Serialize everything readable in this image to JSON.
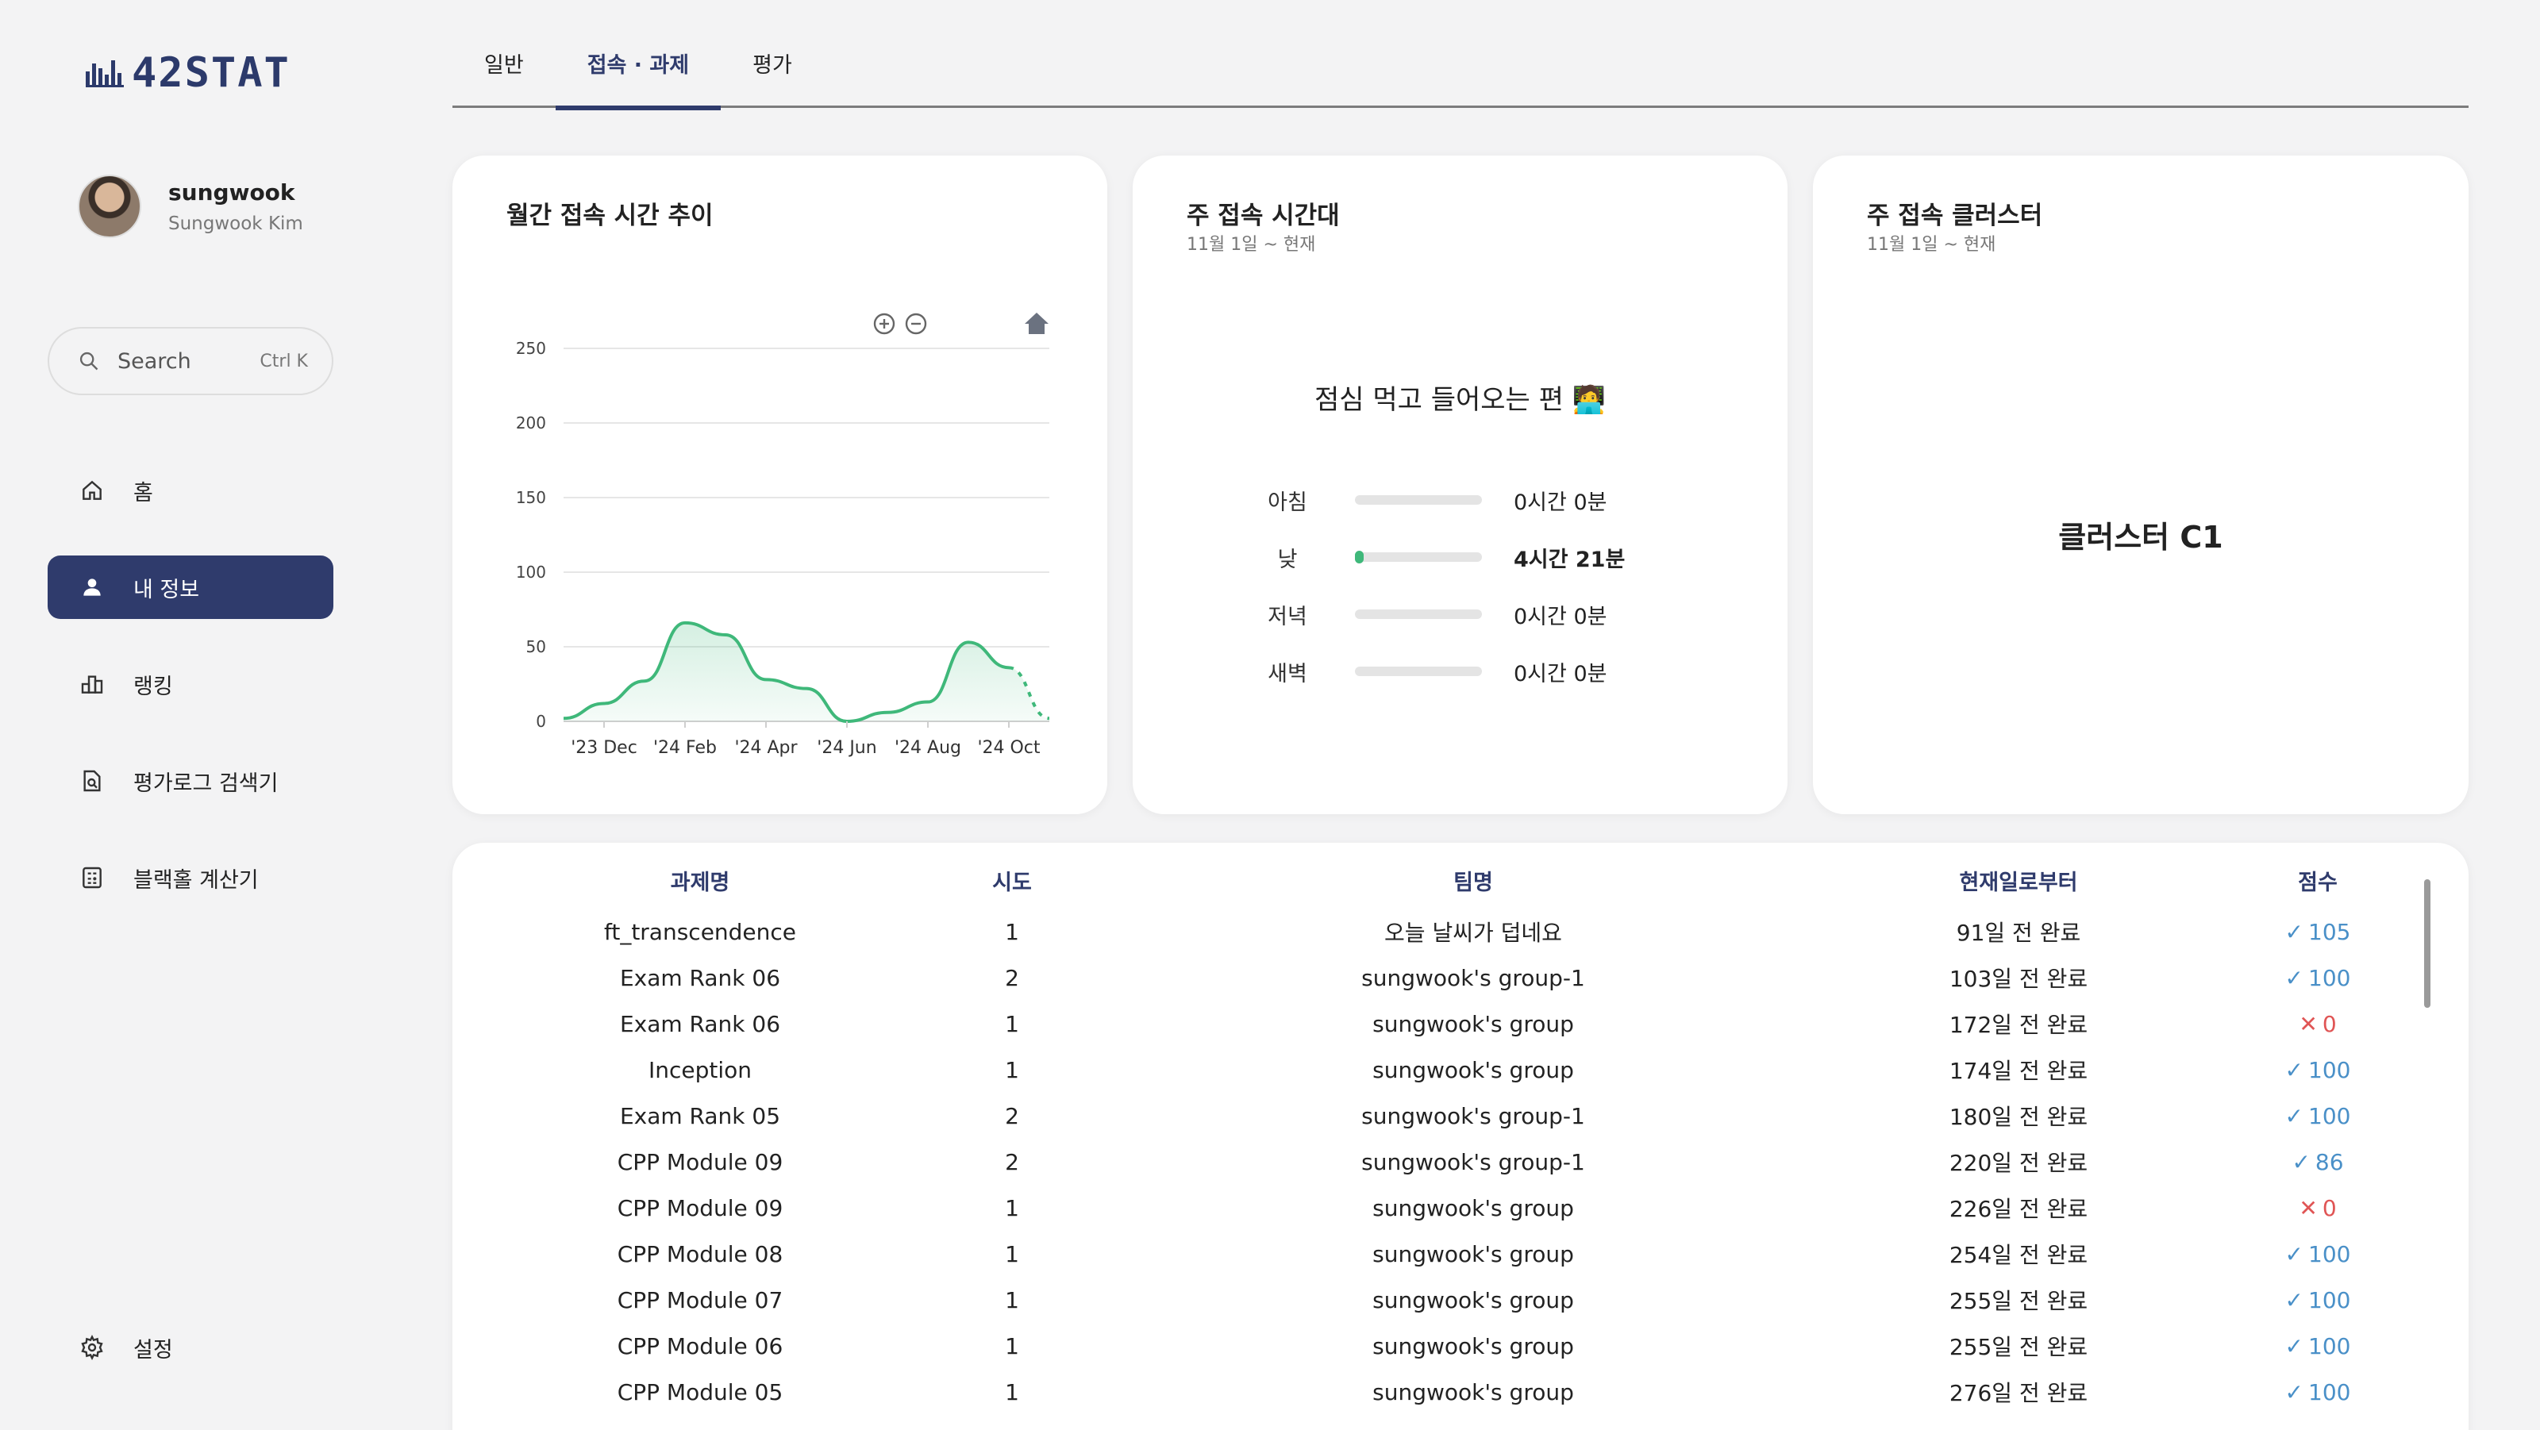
{
  "logo": {
    "text": "42STAT"
  },
  "profile": {
    "login": "sungwook",
    "name": "Sungwook Kim"
  },
  "search": {
    "placeholder": "Search",
    "shortcut": "Ctrl K"
  },
  "nav": [
    {
      "label": "홈",
      "icon": "home-icon"
    },
    {
      "label": "내 정보",
      "icon": "user-icon",
      "active": true
    },
    {
      "label": "랭킹",
      "icon": "ranking-icon"
    },
    {
      "label": "평가로그 검색기",
      "icon": "document-search-icon"
    },
    {
      "label": "블랙홀 계산기",
      "icon": "calculator-icon"
    }
  ],
  "settings": {
    "label": "설정",
    "icon": "gear-icon"
  },
  "tabs": [
    {
      "label": "일반"
    },
    {
      "label": "접속 · 과제",
      "active": true
    },
    {
      "label": "평가"
    }
  ],
  "monthly": {
    "title": "월간 접속 시간 추이"
  },
  "chart_data": {
    "type": "area",
    "title": "월간 접속 시간 추이",
    "xlabel": "",
    "ylabel": "",
    "ylim": [
      0,
      250
    ],
    "yticks": [
      0,
      50,
      100,
      150,
      200,
      250
    ],
    "xtick_labels": [
      "'23 Dec",
      "'24 Feb",
      "'24 Apr",
      "'24 Jun",
      "'24 Aug",
      "'24 Oct"
    ],
    "x": [
      "2023-11",
      "2023-12",
      "2024-01",
      "2024-02",
      "2024-03",
      "2024-04",
      "2024-05",
      "2024-06",
      "2024-07",
      "2024-08",
      "2024-09",
      "2024-10",
      "2024-11"
    ],
    "values": [
      2,
      12,
      27,
      66,
      58,
      28,
      22,
      0,
      6,
      13,
      53,
      36,
      2
    ],
    "projected_last": true,
    "grid": true,
    "color": "#3fb87a"
  },
  "timeslot": {
    "title": "주 접속 시간대",
    "subtitle": "11월 1일 ~ 현재",
    "headline": "점심 먹고 들어오는 편 🧑‍💻",
    "slots": [
      {
        "label": "아침",
        "value": "0시간 0분",
        "fraction": 0
      },
      {
        "label": "낮",
        "value": "4시간 21분",
        "fraction": 0.06,
        "highlight": true
      },
      {
        "label": "저녁",
        "value": "0시간 0분",
        "fraction": 0
      },
      {
        "label": "새벽",
        "value": "0시간 0분",
        "fraction": 0
      }
    ]
  },
  "cluster": {
    "title": "주 접속 클러스터",
    "subtitle": "11월 1일 ~ 현재",
    "value": "클러스터 C1"
  },
  "projects": {
    "headers": [
      "과제명",
      "시도",
      "팀명",
      "현재일로부터",
      "점수"
    ],
    "rows": [
      [
        "ft_transcendence",
        "1",
        "오늘 날씨가 덥네요",
        "91일 전 완료",
        "105",
        true
      ],
      [
        "Exam Rank 06",
        "2",
        "sungwook's group-1",
        "103일 전 완료",
        "100",
        true
      ],
      [
        "Exam Rank 06",
        "1",
        "sungwook's group",
        "172일 전 완료",
        "0",
        false
      ],
      [
        "Inception",
        "1",
        "sungwook's group",
        "174일 전 완료",
        "100",
        true
      ],
      [
        "Exam Rank 05",
        "2",
        "sungwook's group-1",
        "180일 전 완료",
        "100",
        true
      ],
      [
        "CPP Module 09",
        "2",
        "sungwook's group-1",
        "220일 전 완료",
        "86",
        true
      ],
      [
        "CPP Module 09",
        "1",
        "sungwook's group",
        "226일 전 완료",
        "0",
        false
      ],
      [
        "CPP Module 08",
        "1",
        "sungwook's group",
        "254일 전 완료",
        "100",
        true
      ],
      [
        "CPP Module 07",
        "1",
        "sungwook's group",
        "255일 전 완료",
        "100",
        true
      ],
      [
        "CPP Module 06",
        "1",
        "sungwook's group",
        "255일 전 완료",
        "100",
        true
      ],
      [
        "CPP Module 05",
        "1",
        "sungwook's group",
        "276일 전 완료",
        "100",
        true
      ]
    ]
  }
}
